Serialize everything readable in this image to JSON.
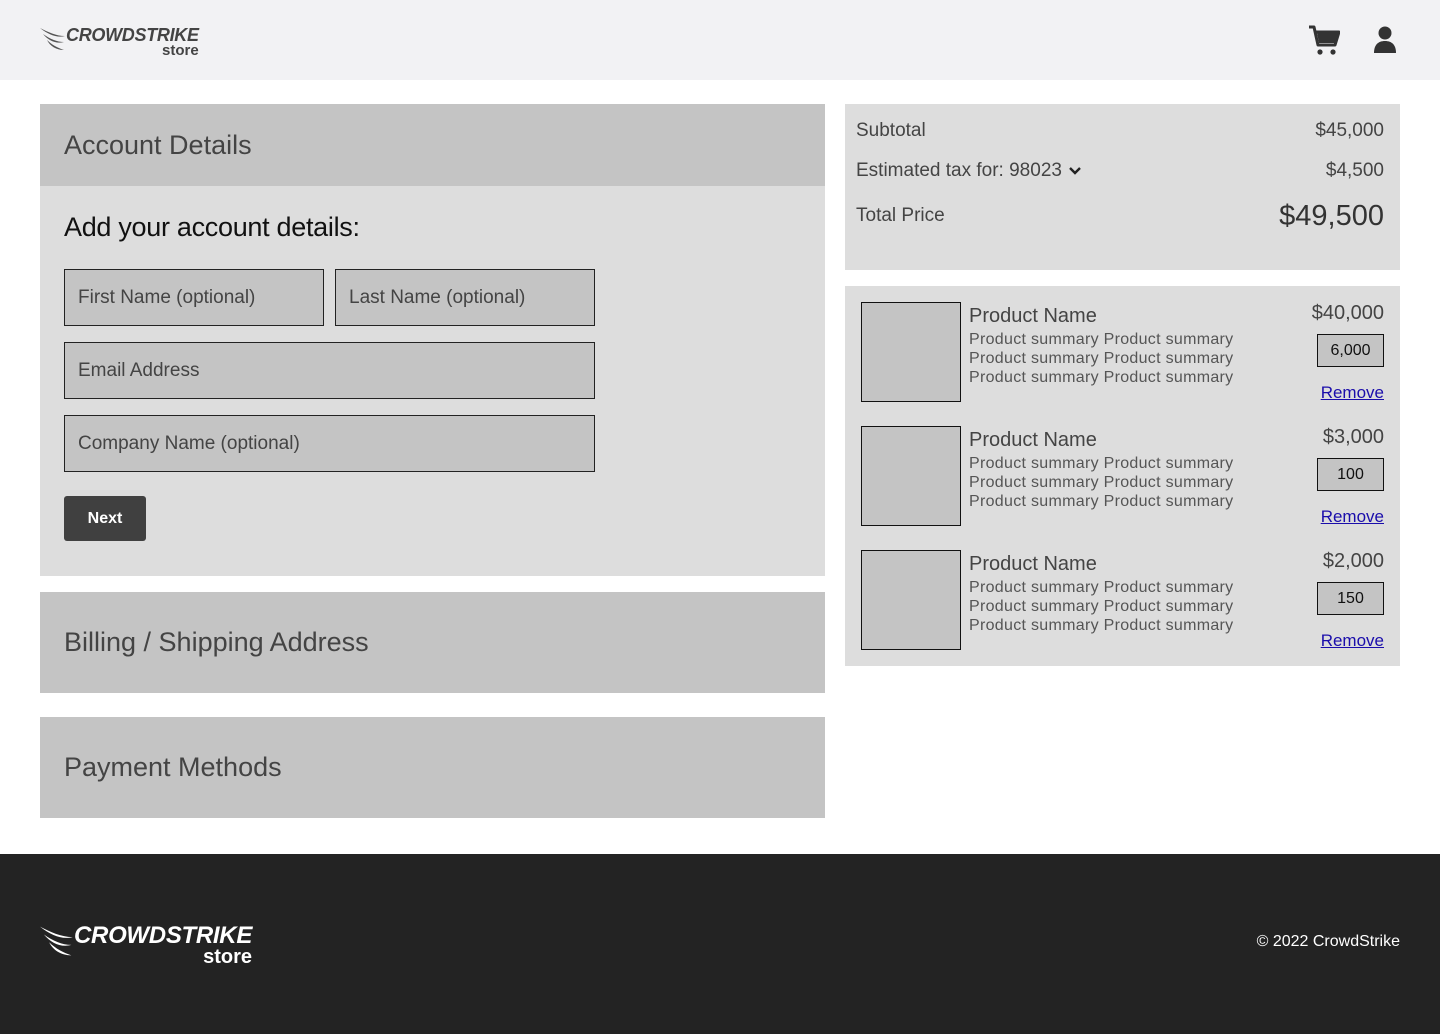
{
  "header": {
    "logo": {
      "word": "CROWDSTRIKE",
      "sub": "store"
    },
    "icons": [
      "cart-icon",
      "user-icon"
    ]
  },
  "account": {
    "heading": "Account Details",
    "form_title": "Add your account details:",
    "first_name_placeholder": "First Name (optional)",
    "last_name_placeholder": "Last Name (optional)",
    "email_placeholder": "Email Address",
    "company_placeholder": "Company Name (optional)",
    "next_label": "Next"
  },
  "billing": {
    "heading": "Billing / Shipping Address"
  },
  "payment": {
    "heading": "Payment Methods"
  },
  "summary": {
    "subtotal_label": "Subtotal",
    "subtotal_value": "$45,000",
    "tax_label": "Estimated tax for: 98023",
    "tax_value": "$4,500",
    "total_label": "Total Price",
    "total_value": "$49,500"
  },
  "cart": {
    "items": [
      {
        "name": "Product Name",
        "summary": "Product summary Product summary Product summary Product summary Product summary Product summary",
        "price": "$40,000",
        "qty": "6,000",
        "remove": "Remove"
      },
      {
        "name": "Product Name",
        "summary": "Product summary Product summary Product summary Product summary Product summary Product summary",
        "price": "$3,000",
        "qty": "100",
        "remove": "Remove"
      },
      {
        "name": "Product Name",
        "summary": "Product summary Product summary Product summary Product summary Product summary Product summary",
        "price": "$2,000",
        "qty": "150",
        "remove": "Remove"
      }
    ]
  },
  "footer": {
    "logo": {
      "word": "CROWDSTRIKE",
      "sub": "store"
    },
    "copyright": "© 2022 CrowdStrike"
  },
  "colors": {
    "header_bg": "#f2f2f4",
    "panel_dark": "#c4c4c4",
    "panel_light": "#dddddd",
    "button_bg": "#404040",
    "footer_bg": "#232323",
    "link": "#1a0dab"
  }
}
